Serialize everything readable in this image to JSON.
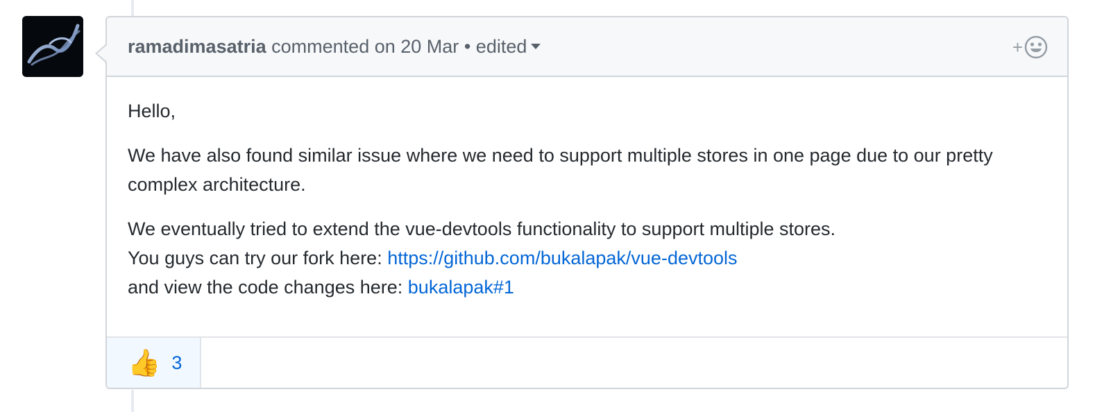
{
  "comment": {
    "author": "ramadimasatria",
    "action": "commented on",
    "date": "20 Mar",
    "separator": "•",
    "edited_label": "edited",
    "body": {
      "greeting": "Hello,",
      "paragraph1": "We have also found similar issue where we need to support multiple stores in one page due to our pretty complex architecture.",
      "line1": "We eventually tried to extend the vue-devtools functionality to support multiple stores.",
      "line2_prefix": "You guys can try our fork here: ",
      "fork_link_text": "https://github.com/bukalapak/vue-devtools",
      "line3_prefix": "and view the code changes here: ",
      "changes_link_text": "bukalapak#1"
    },
    "reactions": [
      {
        "emoji": "👍",
        "icon": "thumbs-up-icon",
        "count": "3"
      }
    ],
    "add_reaction_icon": "smiley-icon",
    "add_reaction_plus": "+"
  },
  "colors": {
    "link": "#0366d6",
    "header_bg": "#f6f8fa",
    "border": "#d1d5da",
    "reaction_bg": "#f1f8ff"
  }
}
